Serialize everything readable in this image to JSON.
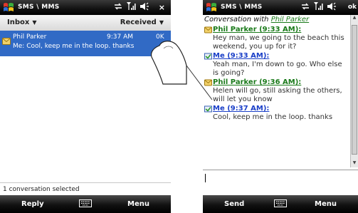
{
  "left": {
    "title": "SMS \\ MMS",
    "close_label": "×",
    "folder_label": "Inbox",
    "sort_label": "Received",
    "message": {
      "sender": "Phil Parker",
      "time": "9:37 AM",
      "size": "0K",
      "preview": "Me: Cool, keep me in the loop. thanks"
    },
    "status_text": "1 conversation selected",
    "softkeys": {
      "left": "Reply",
      "right": "Menu"
    }
  },
  "right": {
    "title": "SMS \\ MMS",
    "ok_label": "ok",
    "conversation_prefix": "Conversation with",
    "contact": "Phil Parker",
    "entries": [
      {
        "who": "Phil Parker (9:33 AM):",
        "text": "Hey man, we going to the beach this weekend, you up for it?"
      },
      {
        "who": "Me (9:33 AM):",
        "text": "Yeah man, I'm down to go. Who else is going?"
      },
      {
        "who": "Phil Parker (9:36 AM):",
        "text": "Helen will go, still asking  the others, will let you know"
      },
      {
        "who": "Me (9:37 AM):",
        "text": "Cool, keep me in the loop. thanks"
      }
    ],
    "softkeys": {
      "left": "Send",
      "right": "Menu"
    }
  },
  "icons": {
    "start": "windows-flag-icon",
    "sync": "sync-arrows-icon",
    "signal": "signal-strength-icon",
    "volume": "speaker-icon",
    "keyboard": "keyboard-icon",
    "message_in": "envelope-icon",
    "message_out": "sent-message-icon"
  },
  "colors": {
    "selection": "#316ac5",
    "incoming_name": "#1a7a1a",
    "outgoing_name": "#1a3fc8",
    "bar": "#111111"
  }
}
